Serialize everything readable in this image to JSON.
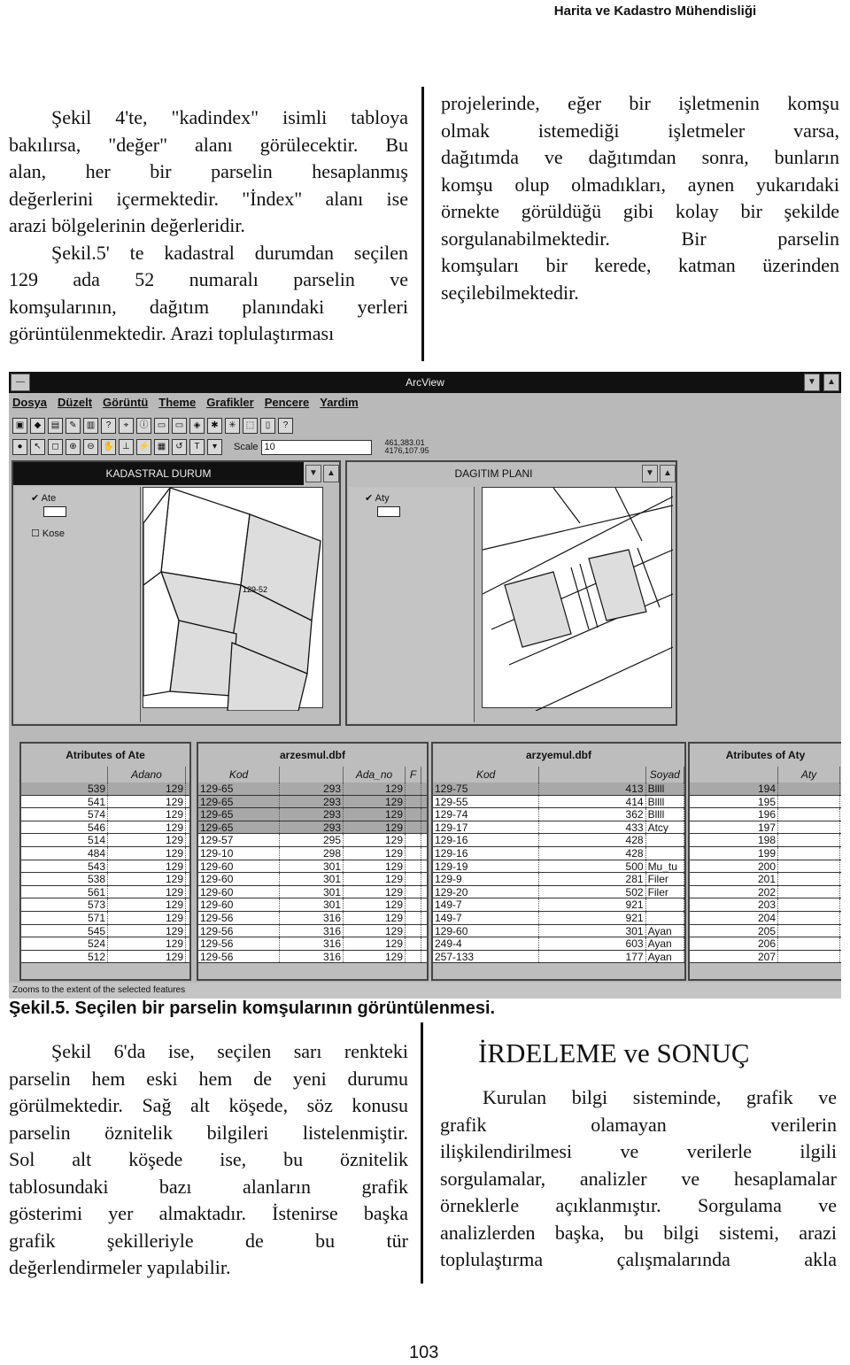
{
  "header": "Harita ve Kadastro Mühendisliği",
  "top_left": [
    "Şekil 4'te, \"kadindex\" isimli tabloya",
    "bakılırsa, \"değer\" alanı görülecektir. Bu",
    "alan, her bir parselin hesaplanmış",
    "değerlerini içermektedir. \"İndex\" alanı ise",
    "arazi bölgelerinin değerleridir.",
    "Şekil.5' te kadastral durumdan seçilen",
    "129 ada 52 numaralı parselin ve",
    "komşularının, dağıtım planındaki yerleri",
    "görüntülenmektedir. Arazi toplulaştırması"
  ],
  "top_right": [
    "projelerinde, eğer bir işletmenin komşu",
    "olmak istemediği işletmeler varsa,",
    "dağıtımda ve dağıtımdan sonra, bunların",
    "komşu olup olmadıkları, aynen yukarıdaki",
    "örnekte görüldüğü gibi kolay bir şekilde",
    "sorgulanabilmektedir. Bir parselin",
    "komşuları bir kerede, katman üzerinden",
    "seçilebilmektedir."
  ],
  "app": {
    "title": "ArcView",
    "menu": [
      "Dosya",
      "Düzelt",
      "Görüntü",
      "Theme",
      "Grafikler",
      "Pencere",
      "Yardim"
    ],
    "scale_label": "Scale",
    "scale_value": "10",
    "coords": [
      "461,383.01",
      "4176,107.95"
    ],
    "views": [
      {
        "title": "KADASTRAL DURUM",
        "legend": [
          "Ate",
          "Kose"
        ],
        "parcel_label": "129-52"
      },
      {
        "title": "DAGITIM PLANI",
        "legend": [
          "Aty"
        ]
      }
    ],
    "tables": [
      {
        "title": "Atributes of Ate",
        "columns": [
          "",
          "Adano"
        ],
        "rows": [
          [
            "539",
            "129"
          ],
          [
            "541",
            "129"
          ],
          [
            "574",
            "129"
          ],
          [
            "546",
            "129"
          ],
          [
            "514",
            "129"
          ],
          [
            "484",
            "129"
          ],
          [
            "543",
            "129"
          ],
          [
            "538",
            "129"
          ],
          [
            "561",
            "129"
          ],
          [
            "573",
            "129"
          ],
          [
            "571",
            "129"
          ],
          [
            "545",
            "129"
          ],
          [
            "524",
            "129"
          ],
          [
            "512",
            "129"
          ]
        ]
      },
      {
        "title": "arzesmul.dbf",
        "columns": [
          "Kod",
          "",
          "Ada_no",
          "F"
        ],
        "rows": [
          [
            "129-65",
            "293",
            "129",
            ""
          ],
          [
            "129-65",
            "293",
            "129",
            ""
          ],
          [
            "129-65",
            "293",
            "129",
            ""
          ],
          [
            "129-65",
            "293",
            "129",
            ""
          ],
          [
            "129-57",
            "295",
            "129",
            ""
          ],
          [
            "129-10",
            "298",
            "129",
            ""
          ],
          [
            "129-60",
            "301",
            "129",
            ""
          ],
          [
            "129-60",
            "301",
            "129",
            ""
          ],
          [
            "129-60",
            "301",
            "129",
            ""
          ],
          [
            "129-60",
            "301",
            "129",
            ""
          ],
          [
            "129-56",
            "316",
            "129",
            ""
          ],
          [
            "129-56",
            "316",
            "129",
            ""
          ],
          [
            "129-56",
            "316",
            "129",
            ""
          ],
          [
            "129-56",
            "316",
            "129",
            ""
          ]
        ]
      },
      {
        "title": "arzyemul.dbf",
        "columns": [
          "Kod",
          "",
          "Soyad"
        ],
        "rows": [
          [
            "129-75",
            "413",
            "Bllll"
          ],
          [
            "129-55",
            "414",
            "Bllll"
          ],
          [
            "129-74",
            "362",
            "Bllll"
          ],
          [
            "129-17",
            "433",
            "Atcy"
          ],
          [
            "129-16",
            "428",
            ""
          ],
          [
            "129-16",
            "428",
            ""
          ],
          [
            "129-19",
            "500",
            "Mu_tu"
          ],
          [
            "129-9",
            "281",
            "Filer"
          ],
          [
            "129-20",
            "502",
            "Filer"
          ],
          [
            "149-7",
            "921",
            ""
          ],
          [
            "149-7",
            "921",
            ""
          ],
          [
            "129-60",
            "301",
            "Ayan"
          ],
          [
            "249-4",
            "603",
            "Ayan"
          ],
          [
            "257-133",
            "177",
            "Ayan"
          ]
        ]
      },
      {
        "title": "Atributes of Aty",
        "columns": [
          "",
          "Aty"
        ],
        "rows": [
          [
            "194",
            ""
          ],
          [
            "195",
            ""
          ],
          [
            "196",
            ""
          ],
          [
            "197",
            ""
          ],
          [
            "198",
            ""
          ],
          [
            "199",
            ""
          ],
          [
            "200",
            ""
          ],
          [
            "201",
            ""
          ],
          [
            "202",
            ""
          ],
          [
            "203",
            ""
          ],
          [
            "204",
            ""
          ],
          [
            "205",
            ""
          ],
          [
            "206",
            ""
          ],
          [
            "207",
            ""
          ]
        ]
      }
    ],
    "status": "Zooms to the extent of the selected features"
  },
  "caption": "Şekil.5. Seçilen bir parselin komşularının görüntülenmesi.",
  "bottom_left": [
    "Şekil 6'da ise, seçilen sarı renkteki",
    "parselin hem eski hem de yeni durumu",
    "görülmektedir. Sağ alt köşede, söz konusu",
    "parselin öznitelik bilgileri listelenmiştir.",
    "Sol alt köşede ise, bu öznitelik",
    "tablosundaki bazı alanların grafik",
    "gösterimi yer almaktadır. İstenirse başka",
    "grafik şekilleriyle de bu tür",
    "değerlendirmeler yapılabilir."
  ],
  "section_heading": "İRDELEME ve SONUÇ",
  "bottom_right": [
    "Kurulan bilgi sisteminde, grafik ve",
    "grafik olamayan verilerin",
    "ilişkilendirilmesi ve verilerle ilgili",
    "sorgulamalar, analizler ve hesaplamalar",
    "örneklerle açıklanmıştır. Sorgulama ve",
    "analizlerden başka, bu bilgi sistemi, arazi",
    "toplulaştırma çalışmalarında akla"
  ],
  "page_number": "103"
}
